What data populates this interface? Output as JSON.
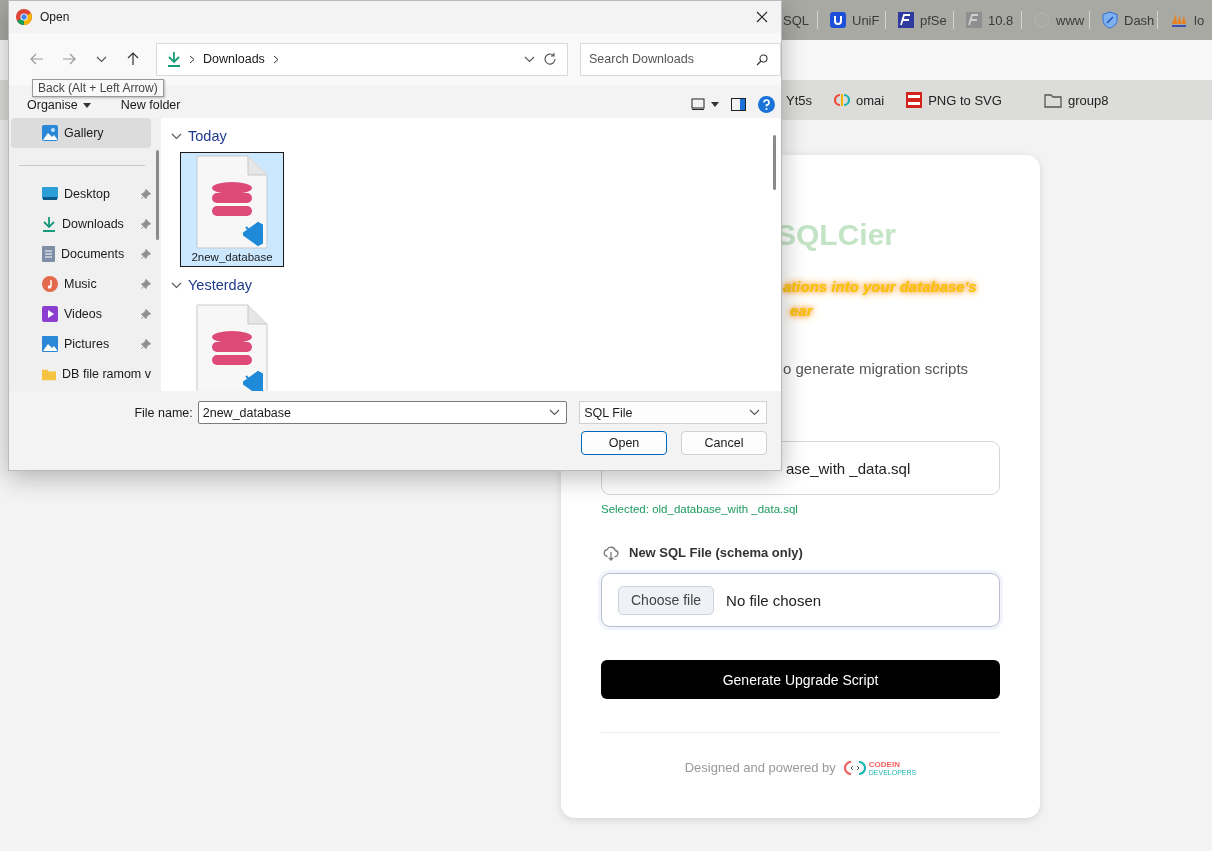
{
  "browser": {
    "tabs": [
      {
        "label": "SQL"
      },
      {
        "label": "UniF"
      },
      {
        "label": "pfSe"
      },
      {
        "label": "10.8"
      },
      {
        "label": "www"
      },
      {
        "label": "Dash"
      },
      {
        "label": "lo"
      }
    ],
    "bookmarks": [
      {
        "label": "Yt5s"
      },
      {
        "label": "omai"
      },
      {
        "label": "PNG to SVG"
      },
      {
        "label": "group8"
      }
    ]
  },
  "card": {
    "title": "SQLCier",
    "subtitle_lines": [
      "ations into your database's",
      "ear"
    ],
    "description": "o generate migration scripts",
    "old_file": {
      "value": "ase_with _data.sql",
      "note": "Selected: old_database_with _data.sql"
    },
    "new_file": {
      "label": "New SQL File (schema only)",
      "button": "Choose file",
      "value": "No file chosen"
    },
    "generate_button": "Generate Upgrade Script",
    "footer": {
      "text": "Designed and powered by",
      "brand": "CODEIN",
      "brand_sub": "DEVELOPERS"
    }
  },
  "dialog": {
    "title": "Open",
    "breadcrumb": "Downloads",
    "search": {
      "placeholder": "Search Downloads"
    },
    "tooltip": "Back (Alt + Left Arrow)",
    "commands": [
      "Organise",
      "New folder"
    ],
    "nav": [
      {
        "label": "Gallery",
        "selected": true,
        "pinned": false
      },
      {
        "label": "Desktop",
        "selected": false,
        "pinned": true
      },
      {
        "label": "Downloads",
        "selected": false,
        "pinned": true
      },
      {
        "label": "Documents",
        "selected": false,
        "pinned": true
      },
      {
        "label": "Music",
        "selected": false,
        "pinned": true
      },
      {
        "label": "Videos",
        "selected": false,
        "pinned": true
      },
      {
        "label": "Pictures",
        "selected": false,
        "pinned": true
      },
      {
        "label": "DB file ramom v",
        "selected": false,
        "pinned": false
      }
    ],
    "groups": [
      {
        "label": "Today",
        "expanded": true,
        "files": [
          {
            "name": "2new_database",
            "selected": true
          }
        ]
      },
      {
        "label": "Yesterday",
        "expanded": true,
        "files": [
          {
            "selected": false
          }
        ]
      }
    ],
    "file_name_label": "File name:",
    "file_name": "2new_database",
    "file_type": "SQL File",
    "buttons": [
      {
        "label": "Open",
        "default": true
      },
      {
        "label": "Cancel",
        "default": false
      }
    ]
  }
}
